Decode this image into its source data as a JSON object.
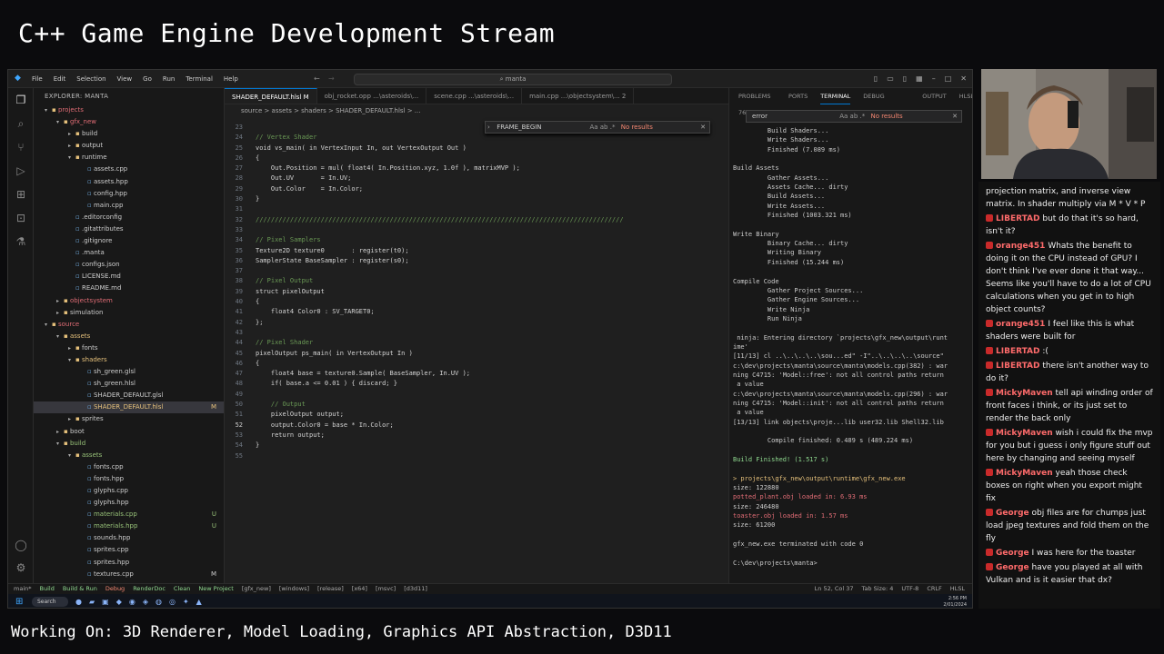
{
  "stream": {
    "title": "C++ Game Engine Development Stream",
    "working_on": "Working On: 3D Renderer, Model Loading, Graphics API Abstraction, D3D11"
  },
  "window": {
    "menu": [
      "File",
      "Edit",
      "Selection",
      "View",
      "Go",
      "Run",
      "Terminal",
      "Help"
    ],
    "search": "manta"
  },
  "explorer": {
    "header": "EXPLORER: MANTA",
    "items": [
      {
        "depth": 0,
        "arrow": "v",
        "label": "projects",
        "color": "#e06c75",
        "badge": ""
      },
      {
        "depth": 1,
        "arrow": "v",
        "label": "gfx_new",
        "color": "#e06c75",
        "badge": ""
      },
      {
        "depth": 2,
        "arrow": ">",
        "label": "build",
        "color": "#ccc",
        "badge": ""
      },
      {
        "depth": 2,
        "arrow": ">",
        "label": "output",
        "color": "#ccc",
        "badge": ""
      },
      {
        "depth": 2,
        "arrow": "v",
        "label": "runtime",
        "color": "#ccc",
        "badge": ""
      },
      {
        "depth": 3,
        "arrow": "",
        "label": "assets.cpp",
        "color": "#ccc",
        "badge": ""
      },
      {
        "depth": 3,
        "arrow": "",
        "label": "assets.hpp",
        "color": "#ccc",
        "badge": ""
      },
      {
        "depth": 3,
        "arrow": "",
        "label": "config.hpp",
        "color": "#ccc",
        "badge": ""
      },
      {
        "depth": 3,
        "arrow": "",
        "label": "main.cpp",
        "color": "#ccc",
        "badge": ""
      },
      {
        "depth": 2,
        "arrow": "",
        "label": ".editorconfig",
        "color": "#ccc",
        "badge": ""
      },
      {
        "depth": 2,
        "arrow": "",
        "label": ".gitattributes",
        "color": "#ccc",
        "badge": ""
      },
      {
        "depth": 2,
        "arrow": "",
        "label": ".gitignore",
        "color": "#ccc",
        "badge": ""
      },
      {
        "depth": 2,
        "arrow": "",
        "label": ".manta",
        "color": "#ccc",
        "badge": ""
      },
      {
        "depth": 2,
        "arrow": "",
        "label": "configs.json",
        "color": "#ccc",
        "badge": ""
      },
      {
        "depth": 2,
        "arrow": "",
        "label": "LICENSE.md",
        "color": "#ccc",
        "badge": ""
      },
      {
        "depth": 2,
        "arrow": "",
        "label": "README.md",
        "color": "#ccc",
        "badge": ""
      },
      {
        "depth": 1,
        "arrow": ">",
        "label": "objectsystem",
        "color": "#e06c75",
        "badge": ""
      },
      {
        "depth": 1,
        "arrow": ">",
        "label": "simulation",
        "color": "#ccc",
        "badge": ""
      },
      {
        "depth": 0,
        "arrow": "v",
        "label": "source",
        "color": "#e06c75",
        "badge": ""
      },
      {
        "depth": 1,
        "arrow": "v",
        "label": "assets",
        "color": "#e5c07b",
        "badge": ""
      },
      {
        "depth": 2,
        "arrow": ">",
        "label": "fonts",
        "color": "#ccc",
        "badge": ""
      },
      {
        "depth": 2,
        "arrow": "v",
        "label": "shaders",
        "color": "#e5c07b",
        "badge": ""
      },
      {
        "depth": 3,
        "arrow": "",
        "label": "sh_green.glsl",
        "color": "#ccc",
        "badge": ""
      },
      {
        "depth": 3,
        "arrow": "",
        "label": "sh_green.hlsl",
        "color": "#ccc",
        "badge": ""
      },
      {
        "depth": 3,
        "arrow": "",
        "label": "SHADER_DEFAULT.glsl",
        "color": "#ccc",
        "badge": ""
      },
      {
        "depth": 3,
        "arrow": "",
        "label": "SHADER_DEFAULT.hlsl",
        "color": "#e5c07b",
        "badge": "M",
        "selected": true
      },
      {
        "depth": 2,
        "arrow": ">",
        "label": "sprites",
        "color": "#ccc",
        "badge": ""
      },
      {
        "depth": 1,
        "arrow": ">",
        "label": "boot",
        "color": "#ccc",
        "badge": ""
      },
      {
        "depth": 1,
        "arrow": "v",
        "label": "build",
        "color": "#98c379",
        "badge": ""
      },
      {
        "depth": 2,
        "arrow": "v",
        "label": "assets",
        "color": "#98c379",
        "badge": ""
      },
      {
        "depth": 3,
        "arrow": "",
        "label": "fonts.cpp",
        "color": "#ccc",
        "badge": ""
      },
      {
        "depth": 3,
        "arrow": "",
        "label": "fonts.hpp",
        "color": "#ccc",
        "badge": ""
      },
      {
        "depth": 3,
        "arrow": "",
        "label": "glyphs.cpp",
        "color": "#ccc",
        "badge": ""
      },
      {
        "depth": 3,
        "arrow": "",
        "label": "glyphs.hpp",
        "color": "#ccc",
        "badge": ""
      },
      {
        "depth": 3,
        "arrow": "",
        "label": "materials.cpp",
        "color": "#98c379",
        "badge": "U"
      },
      {
        "depth": 3,
        "arrow": "",
        "label": "materials.hpp",
        "color": "#98c379",
        "badge": "U"
      },
      {
        "depth": 3,
        "arrow": "",
        "label": "sounds.hpp",
        "color": "#ccc",
        "badge": ""
      },
      {
        "depth": 3,
        "arrow": "",
        "label": "sprites.cpp",
        "color": "#ccc",
        "badge": ""
      },
      {
        "depth": 3,
        "arrow": "",
        "label": "sprites.hpp",
        "color": "#ccc",
        "badge": ""
      },
      {
        "depth": 3,
        "arrow": "",
        "label": "textures.cpp",
        "color": "#ccc",
        "badge": "M"
      }
    ]
  },
  "editor": {
    "tabs": [
      {
        "label": "SHADER_DEFAULT.hlsl M",
        "active": true
      },
      {
        "label": "obj_rocket.opp ...\\asteroids\\...",
        "active": false
      },
      {
        "label": "scene.cpp ...\\asteroids\\...",
        "active": false
      },
      {
        "label": "main.cpp ...\\objectsystem\\... 2",
        "active": false
      }
    ],
    "breadcrumb": "source > assets > shaders > SHADER_DEFAULT.hlsl > ...",
    "find_text": "FRAME_BEGIN",
    "find_result": "No results",
    "lines": [
      {
        "n": "23",
        "t": ""
      },
      {
        "n": "24",
        "t": "// Vertex Shader"
      },
      {
        "n": "25",
        "t": "void vs_main( in VertexInput In, out VertexOutput Out )"
      },
      {
        "n": "26",
        "t": "{"
      },
      {
        "n": "27",
        "t": "    Out.Position = mul( float4( In.Position.xyz, 1.0f ), matrixMVP );"
      },
      {
        "n": "28",
        "t": "    Out.UV       = In.UV;"
      },
      {
        "n": "29",
        "t": "    Out.Color    = In.Color;"
      },
      {
        "n": "30",
        "t": "}"
      },
      {
        "n": "31",
        "t": ""
      },
      {
        "n": "32",
        "t": "////////////////////////////////////////////////////////////////////////////////////////////////"
      },
      {
        "n": "33",
        "t": ""
      },
      {
        "n": "34",
        "t": "// Pixel Samplers"
      },
      {
        "n": "35",
        "t": "Texture2D texture0       : register(t0);"
      },
      {
        "n": "36",
        "t": "SamplerState BaseSampler : register(s0);"
      },
      {
        "n": "37",
        "t": ""
      },
      {
        "n": "38",
        "t": "// Pixel Output"
      },
      {
        "n": "39",
        "t": "struct pixelOutput"
      },
      {
        "n": "40",
        "t": "{"
      },
      {
        "n": "41",
        "t": "    float4 Color0 : SV_TARGET0;"
      },
      {
        "n": "42",
        "t": "};"
      },
      {
        "n": "43",
        "t": ""
      },
      {
        "n": "44",
        "t": "// Pixel Shader"
      },
      {
        "n": "45",
        "t": "pixelOutput ps_main( in VertexOutput In )"
      },
      {
        "n": "46",
        "t": "{"
      },
      {
        "n": "47",
        "t": "    float4 base = texture0.Sample( BaseSampler, In.UV );"
      },
      {
        "n": "48",
        "t": "    if( base.a <= 0.01 ) { discard; }"
      },
      {
        "n": "49",
        "t": ""
      },
      {
        "n": "50",
        "t": "    // Output"
      },
      {
        "n": "51",
        "t": "    pixelOutput output;"
      },
      {
        "n": "52",
        "t": "    output.Color0 = base * In.Color;"
      },
      {
        "n": "53",
        "t": "    return output;"
      },
      {
        "n": "54",
        "t": "}"
      },
      {
        "n": "55",
        "t": ""
      }
    ]
  },
  "panel": {
    "tabs": [
      "PROBLEMS 76",
      "PORTS",
      "TERMINAL",
      "DEBUG CONSOLE",
      "OUTPUT",
      "HLSL"
    ],
    "find_text": "error",
    "find_result": "No results",
    "lines": [
      {
        "t": "         Build Shaders...",
        "c": "#ccc"
      },
      {
        "t": "         Write Shaders...",
        "c": "#ccc"
      },
      {
        "t": "         Finished (7.089 ms)",
        "c": "#ccc"
      },
      {
        "t": "",
        "c": "#ccc"
      },
      {
        "t": "Build Assets",
        "c": "#ccc"
      },
      {
        "t": "         Gather Assets...",
        "c": "#ccc"
      },
      {
        "t": "         Assets Cache... dirty",
        "c": "#ccc"
      },
      {
        "t": "         Build Assets...",
        "c": "#ccc"
      },
      {
        "t": "         Write Assets...",
        "c": "#ccc"
      },
      {
        "t": "         Finished (1003.321 ms)",
        "c": "#ccc"
      },
      {
        "t": "",
        "c": "#ccc"
      },
      {
        "t": "Write Binary",
        "c": "#ccc"
      },
      {
        "t": "         Binary Cache... dirty",
        "c": "#ccc"
      },
      {
        "t": "         Writing Binary",
        "c": "#ccc"
      },
      {
        "t": "         Finished (15.244 ms)",
        "c": "#ccc"
      },
      {
        "t": "",
        "c": "#ccc"
      },
      {
        "t": "Compile Code",
        "c": "#ccc"
      },
      {
        "t": "         Gather Project Sources...",
        "c": "#ccc"
      },
      {
        "t": "         Gather Engine Sources...",
        "c": "#ccc"
      },
      {
        "t": "         Write Ninja",
        "c": "#ccc"
      },
      {
        "t": "         Run Ninja",
        "c": "#ccc"
      },
      {
        "t": "",
        "c": "#ccc"
      },
      {
        "t": " ninja: Entering directory `projects\\gfx_new\\output\\runt",
        "c": "#ccc"
      },
      {
        "t": "ime'",
        "c": "#ccc"
      },
      {
        "t": "[11/13] cl ..\\..\\..\\..\\sou...ed\" -I\"..\\..\\..\\..\\source\"",
        "c": "#ccc"
      },
      {
        "t": "c:\\dev\\projects\\manta\\source\\manta\\models.cpp(382) : war",
        "c": "#ccc"
      },
      {
        "t": "ning C4715: 'Model::free': not all control paths return",
        "c": "#ccc"
      },
      {
        "t": " a value",
        "c": "#ccc"
      },
      {
        "t": "c:\\dev\\projects\\manta\\source\\manta\\models.cpp(296) : war",
        "c": "#ccc"
      },
      {
        "t": "ning C4715: 'Model::init': not all control paths return",
        "c": "#ccc"
      },
      {
        "t": " a value",
        "c": "#ccc"
      },
      {
        "t": "[13/13] link objects\\proje...lib user32.lib Shell32.lib",
        "c": "#ccc"
      },
      {
        "t": "",
        "c": "#ccc"
      },
      {
        "t": "         Compile finished: 0.489 s (489.224 ms)",
        "c": "#ccc"
      },
      {
        "t": "",
        "c": "#ccc"
      },
      {
        "t": "Build Finished! (1.517 s)",
        "c": "#8fd98f"
      },
      {
        "t": "",
        "c": "#ccc"
      },
      {
        "t": "> projects\\gfx_new\\output\\runtime\\gfx_new.exe",
        "c": "#e5c07b"
      },
      {
        "t": "size: 122880",
        "c": "#ccc"
      },
      {
        "t": "potted_plant.obj loaded in: 6.93 ms",
        "c": "#e06c75"
      },
      {
        "t": "size: 246480",
        "c": "#ccc"
      },
      {
        "t": "toaster.obj loaded in: 1.57 ms",
        "c": "#e06c75"
      },
      {
        "t": "size: 61200",
        "c": "#ccc"
      },
      {
        "t": "",
        "c": "#ccc"
      },
      {
        "t": "gfx_new.exe terminated with code 0",
        "c": "#ccc"
      },
      {
        "t": "",
        "c": "#ccc"
      },
      {
        "t": "C:\\dev\\projects\\manta>",
        "c": "#ccc"
      }
    ]
  },
  "statusbar": {
    "left": [
      "main*",
      "Build",
      "Build & Run",
      "Debug",
      "RenderDoc",
      "Clean",
      "New Project",
      "[gfx_new]",
      "[windows]",
      "[release]",
      "[x64]",
      "[msvc]",
      "[d3d11]"
    ],
    "right": [
      "Ln 52, Col 37",
      "Tab Size: 4",
      "UTF-8",
      "CRLF",
      "HLSL"
    ]
  },
  "taskbar": {
    "search": "Search",
    "time": "2:56 PM",
    "date": "2/01/2024"
  },
  "chat": [
    {
      "user": "",
      "color": "#eee",
      "text": "projection matrix, and inverse view matrix. In shader multiply via M * V * P"
    },
    {
      "user": "LIBERTAD",
      "color": "#ff6b6b",
      "text": "but do that it's so hard, isn't it?"
    },
    {
      "user": "orange451",
      "color": "#ff6b6b",
      "text": "Whats the benefit to doing it on the CPU instead of GPU? I don't think I've ever done it that way... Seems like you'll have to do a lot of CPU calculations when you get in to high object counts?"
    },
    {
      "user": "orange451",
      "color": "#ff6b6b",
      "text": "I feel like this is what shaders were built for"
    },
    {
      "user": "LIBERTAD",
      "color": "#ff6b6b",
      "text": ":("
    },
    {
      "user": "LIBERTAD",
      "color": "#ff6b6b",
      "text": "there isn't another way to do it?"
    },
    {
      "user": "MickyMaven",
      "color": "#ff6b6b",
      "text": "tell api winding order of front faces i think, or its just set to render the back only"
    },
    {
      "user": "MickyMaven",
      "color": "#ff6b6b",
      "text": "wish i could fix the mvp for you but i guess i only figure stuff out here by changing and seeing myself"
    },
    {
      "user": "MickyMaven",
      "color": "#ff6b6b",
      "text": "yeah those check boxes on right when you export might fix"
    },
    {
      "user": "George",
      "color": "#ff6b6b",
      "text": "obj files are for chumps just load jpeg textures and fold them on the fly"
    },
    {
      "user": "George",
      "color": "#ff6b6b",
      "text": "I was here for the toaster"
    },
    {
      "user": "George",
      "color": "#ff6b6b",
      "text": "have you played at all with Vulkan and is it easier that dx?"
    }
  ]
}
